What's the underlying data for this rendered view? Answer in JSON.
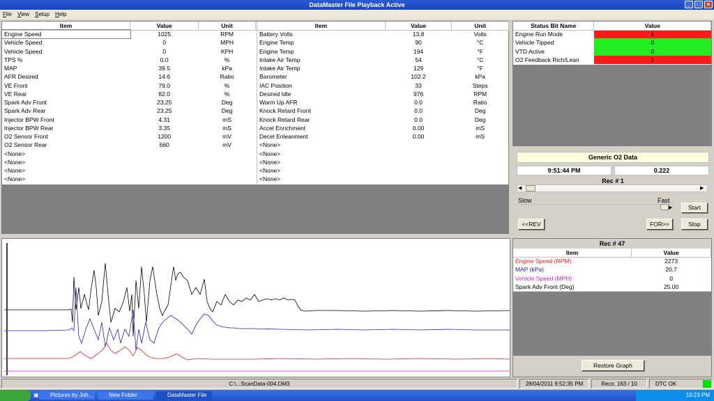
{
  "window": {
    "title": "DataMaster File Playback Active"
  },
  "menu": [
    "File",
    "View",
    "Setup",
    "Help"
  ],
  "left_table": {
    "headers": [
      "Item",
      "Value",
      "Unit"
    ],
    "rows": [
      [
        "Engine Speed",
        "1025",
        "RPM"
      ],
      [
        "Vehicle Speed",
        "0",
        "MPH"
      ],
      [
        "Vehicle Speed",
        "0",
        "KPH"
      ],
      [
        "TPS %",
        "0.0",
        "%"
      ],
      [
        "MAP",
        "39.5",
        "kPa"
      ],
      [
        "AFR Desired",
        "14.6",
        "Ratio"
      ],
      [
        "VE Front",
        "79.0",
        "%"
      ],
      [
        "VE Rear",
        "82.0",
        "%"
      ],
      [
        "Spark Adv Front",
        "23.25",
        "Deg"
      ],
      [
        "Spark Adv Rear",
        "23.25",
        "Deg"
      ],
      [
        "Injector BPW Front",
        "4.31",
        "mS"
      ],
      [
        "Injector BPW Rear",
        "3.35",
        "mS"
      ],
      [
        "O2 Sensor Front",
        "1200",
        "mV"
      ],
      [
        "O2 Sensor Rear",
        "660",
        "mV"
      ],
      [
        "<None>",
        "",
        ""
      ],
      [
        "<None>",
        "",
        ""
      ],
      [
        "<None>",
        "",
        ""
      ],
      [
        "<None>",
        "",
        ""
      ]
    ]
  },
  "mid_table": {
    "headers": [
      "Item",
      "Value",
      "Unit"
    ],
    "rows": [
      [
        "Battery Volts",
        "13.8",
        "Volts"
      ],
      [
        "Engine Temp",
        "90",
        "°C"
      ],
      [
        "Engine Temp",
        "194",
        "°F"
      ],
      [
        "Intake Air Temp",
        "54",
        "°C"
      ],
      [
        "Intake Air Temp",
        "129",
        "°F"
      ],
      [
        "Barometer",
        "102.2",
        "kPa"
      ],
      [
        "IAC Position",
        "33",
        "Steps"
      ],
      [
        "Desired Idle",
        "976",
        "RPM"
      ],
      [
        "Warm Up AFR",
        "0.0",
        "Ratio"
      ],
      [
        "Knock Retard Front",
        "0.0",
        "Deg"
      ],
      [
        "Knock Retard Rear",
        "0.0",
        "Deg"
      ],
      [
        "Accel Enrichment",
        "0.00",
        "mS"
      ],
      [
        "Decel Enleanment",
        "0.00",
        "mS"
      ],
      [
        "<None>",
        "",
        ""
      ],
      [
        "<None>",
        "",
        ""
      ],
      [
        "<None>",
        "",
        ""
      ],
      [
        "<None>",
        "",
        ""
      ],
      [
        "<None>",
        "",
        ""
      ]
    ]
  },
  "status_table": {
    "headers": [
      "Status Bit Name",
      "Value"
    ],
    "rows": [
      {
        "name": "Engine Run Mode",
        "value": "1",
        "color": "#ff1a1a"
      },
      {
        "name": "Vehicle Tipped",
        "value": "0",
        "color": "#22ee22"
      },
      {
        "name": "VTD Active",
        "value": "0",
        "color": "#22ee22"
      },
      {
        "name": "O2 Feedback Rich/Lean",
        "value": "1",
        "color": "#ff1a1a"
      }
    ]
  },
  "playback": {
    "generic_label": "Generic O2 Data",
    "time": "9:51:44 PM",
    "o2_value": "0.222",
    "rec_label": "Rec # 1",
    "slow_label": "Slow",
    "fast_label": "Fast",
    "start_btn": "Start",
    "rev_btn": "<<REV",
    "for_btn": "FOR>>",
    "stop_btn": "Stop"
  },
  "graph_values": {
    "rec_label": "Rec # 47",
    "headers": [
      "Item",
      "Value"
    ],
    "rows": [
      {
        "name": "Engine Speed (RPM)",
        "value": "2273",
        "color": "#e02020"
      },
      {
        "name": "MAP (kPa)",
        "value": "20.7",
        "color": "#2020c0"
      },
      {
        "name": "Vehicle Speed (MPH)",
        "value": "0",
        "color": "#d020d0"
      },
      {
        "name": "Spark Adv Front (Deg)",
        "value": "25.00",
        "color": "#000000"
      }
    ],
    "restore_btn": "Restore Graph"
  },
  "statusbar": {
    "file": "C:\\...ScanData-004.DM3",
    "datetime": "28/04/2011  9:52:35 PM",
    "recs": "Recs: 163 / 10",
    "dtc": "DTC OK",
    "dtc_color": "#00e000"
  },
  "taskbar": {
    "tasks": [
      "Pictures by Joh...",
      "New Folder",
      "DataMaster File ..."
    ],
    "clock": "10:23 PM"
  }
}
